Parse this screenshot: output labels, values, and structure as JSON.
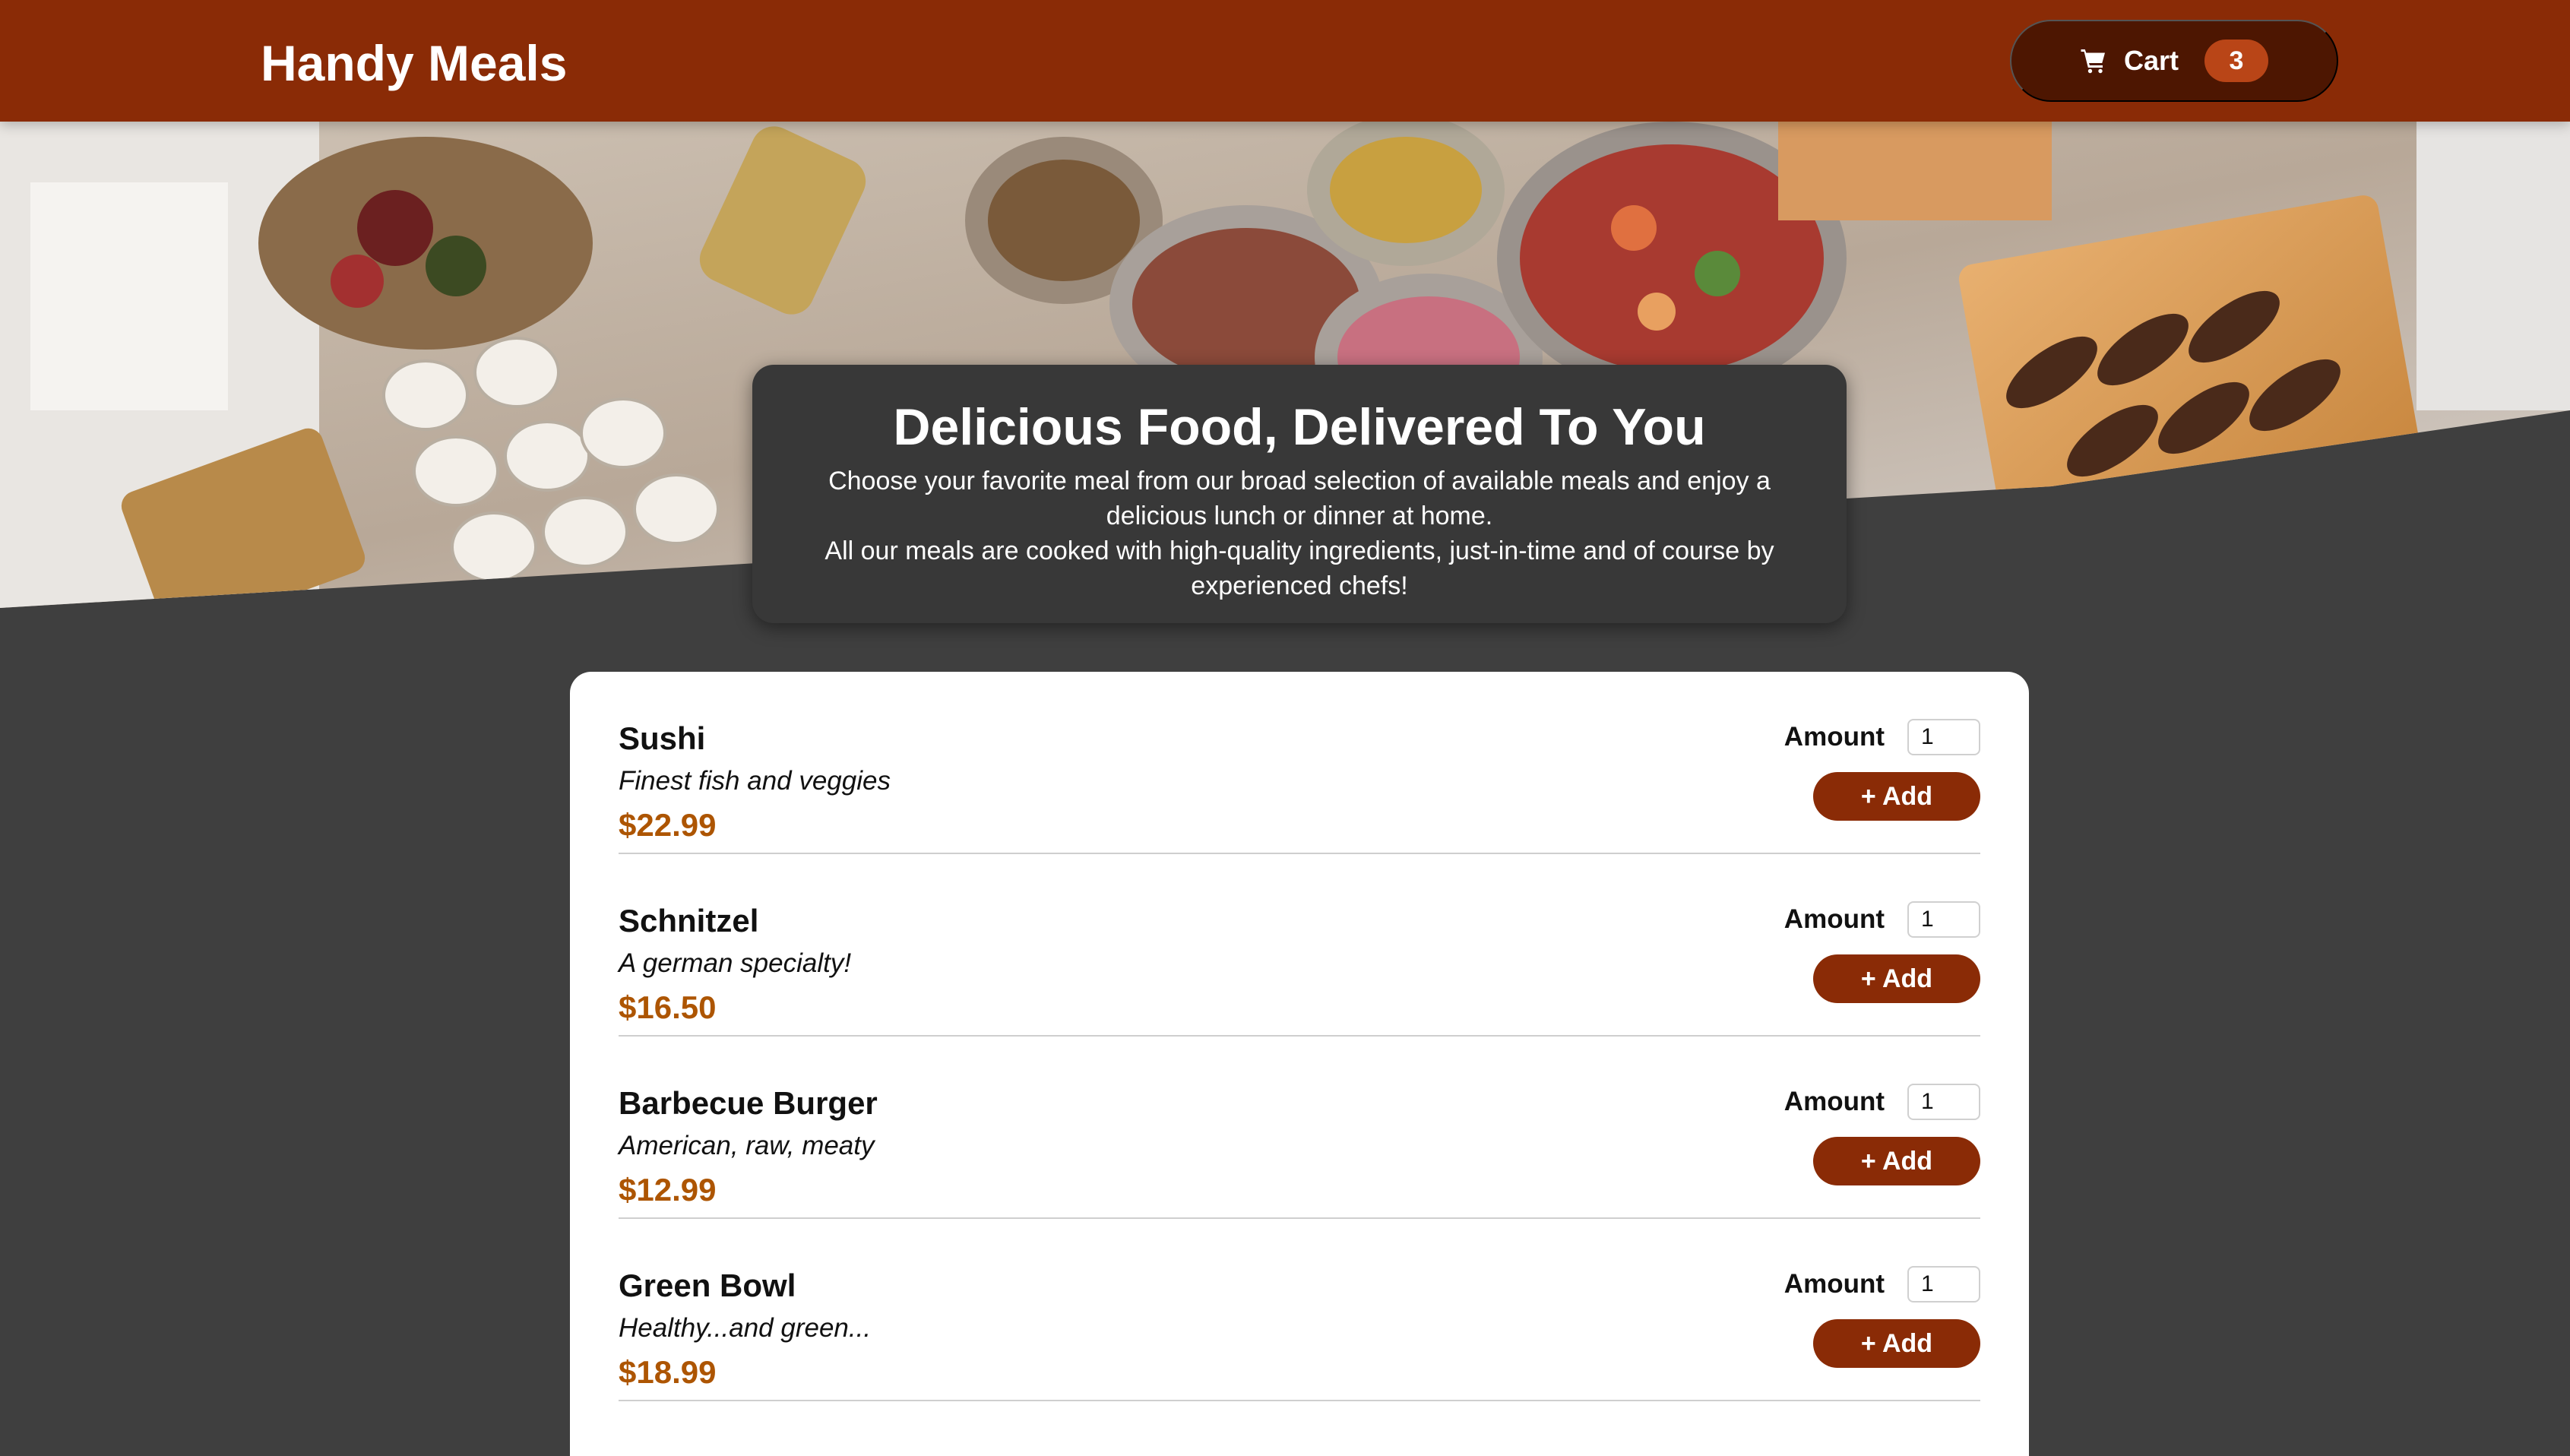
{
  "header": {
    "brand": "Handy Meals",
    "cart_label": "Cart",
    "cart_count": "3",
    "cart_icon": "shopping-cart-icon"
  },
  "summary": {
    "title": "Delicious Food, Delivered To You",
    "line1": "Choose your favorite meal from our broad selection of available meals and enjoy a delicious lunch or dinner at home.",
    "line2": "All our meals are cooked with high-quality ingredients, just-in-time and of course by experienced chefs!"
  },
  "meals": [
    {
      "name": "Sushi",
      "description": "Finest fish and veggies",
      "price": "$22.99",
      "amount_label": "Amount",
      "amount": "1",
      "add_label": "+ Add"
    },
    {
      "name": "Schnitzel",
      "description": "A german specialty!",
      "price": "$16.50",
      "amount_label": "Amount",
      "amount": "1",
      "add_label": "+ Add"
    },
    {
      "name": "Barbecue Burger",
      "description": "American, raw, meaty",
      "price": "$12.99",
      "amount_label": "Amount",
      "amount": "1",
      "add_label": "+ Add"
    },
    {
      "name": "Green Bowl",
      "description": "Healthy...and green...",
      "price": "$18.99",
      "amount_label": "Amount",
      "amount": "1",
      "add_label": "+ Add"
    }
  ],
  "colors": {
    "header_bg": "#8a2b06",
    "cart_button_bg": "#4d1601",
    "cart_badge_bg": "#b94517",
    "page_bg": "#3f3f3f",
    "summary_bg": "#383838",
    "price": "#ad5502",
    "add_button_bg": "#8a2b06"
  }
}
